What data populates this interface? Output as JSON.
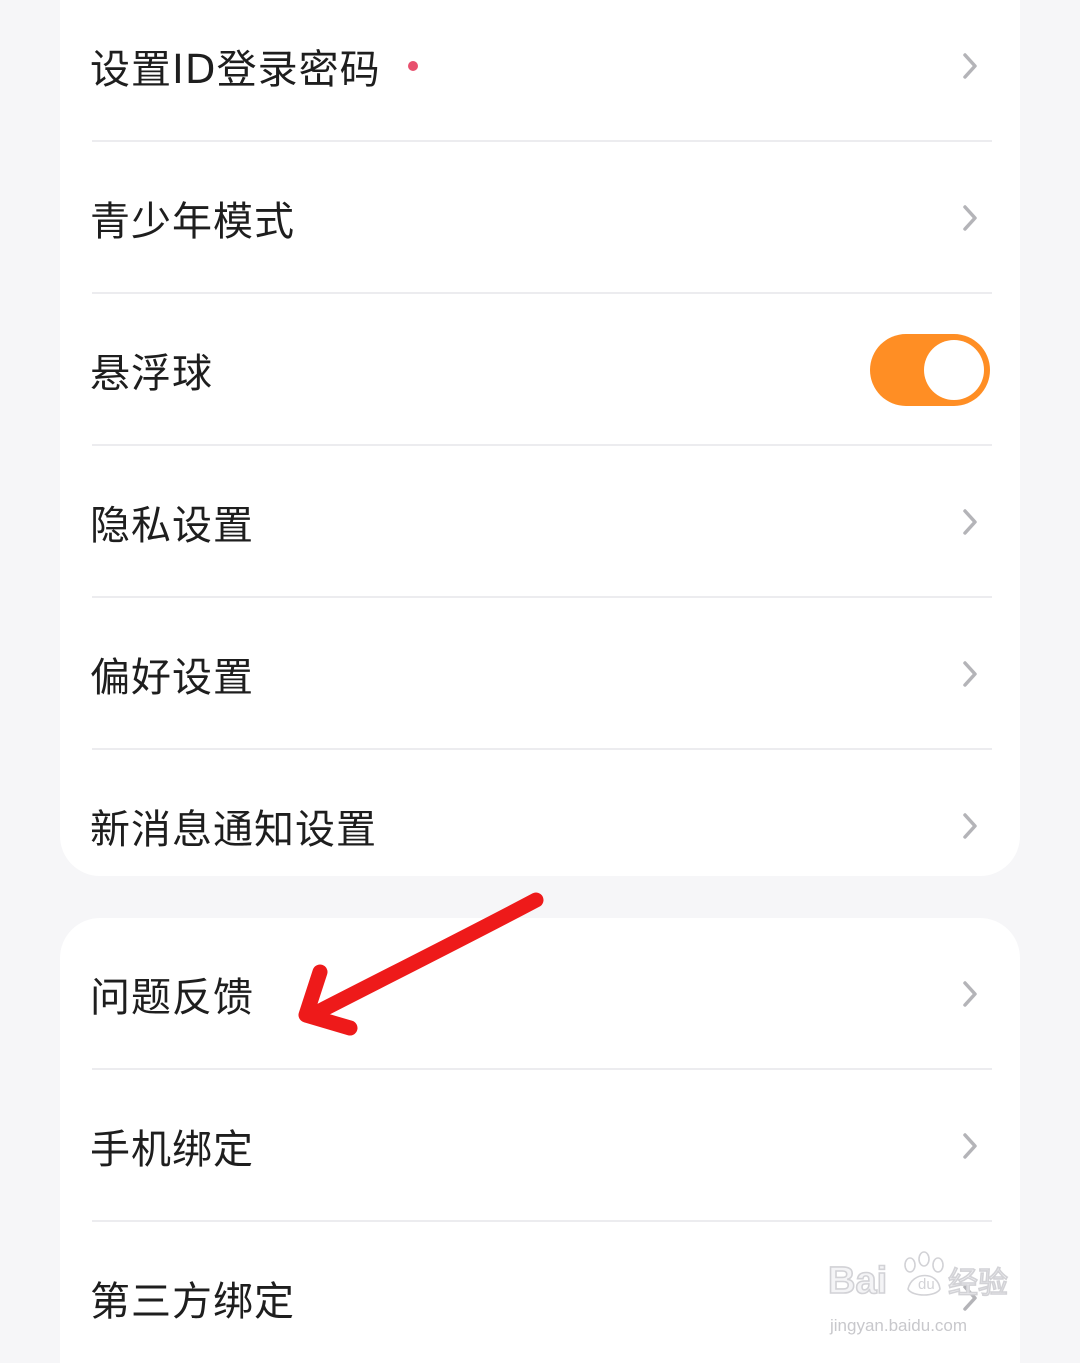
{
  "settings_group_1": {
    "items": [
      {
        "label": "设置ID登录密码"
      },
      {
        "label": "青少年模式"
      },
      {
        "label": "悬浮球",
        "toggle_on": true
      },
      {
        "label": "隐私设置"
      },
      {
        "label": "偏好设置"
      },
      {
        "label": "新消息通知设置"
      }
    ]
  },
  "settings_group_2": {
    "items": [
      {
        "label": "问题反馈"
      },
      {
        "label": "手机绑定"
      },
      {
        "label": "第三方绑定"
      }
    ]
  },
  "icons": {
    "chevron": "chevron-right-icon",
    "annotation": "red-arrow-annotation"
  },
  "colors": {
    "toggle_on": "#ff8e24",
    "badge_dot": "#e8506e",
    "annotation_arrow": "#ee1a1a"
  },
  "watermark": {
    "brand": "Baidu经验",
    "url": "jingyan.baidu.com"
  }
}
